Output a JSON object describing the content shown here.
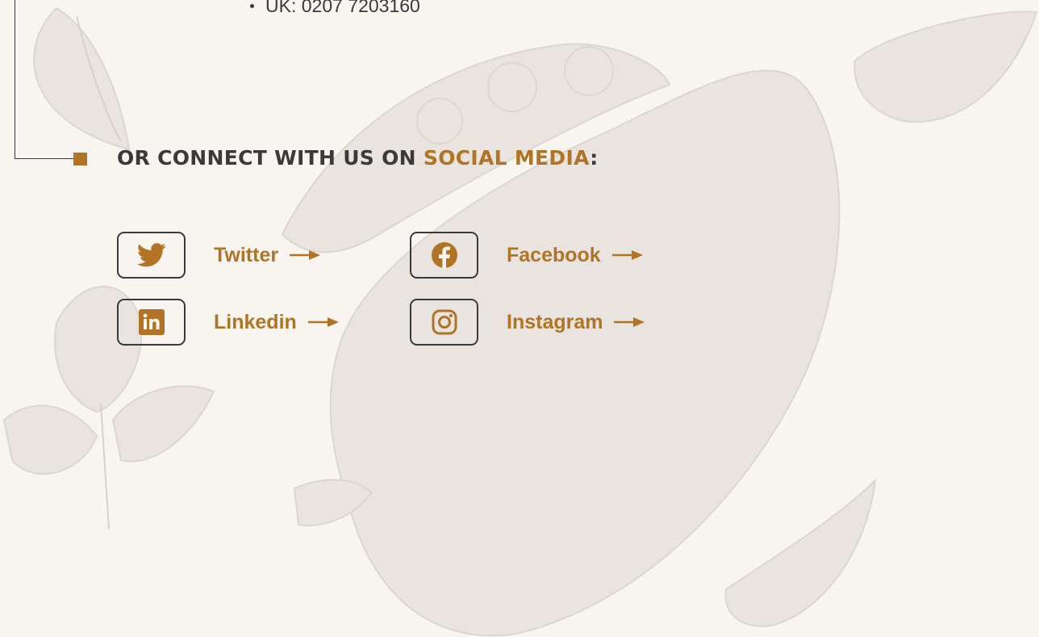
{
  "contact": {
    "phone_uk": "UK: 0207 7203160"
  },
  "section": {
    "heading_prefix": "OR CONNECT WITH US ON ",
    "heading_accent": "SOCIAL MEDIA",
    "heading_suffix": ":"
  },
  "social": {
    "twitter": {
      "label": "Twitter",
      "icon": "twitter-bird-icon"
    },
    "facebook": {
      "label": "Facebook",
      "icon": "facebook-icon"
    },
    "linkedin": {
      "label": "Linkedin",
      "icon": "linkedin-icon"
    },
    "instagram": {
      "label": "Instagram",
      "icon": "instagram-icon"
    }
  },
  "colors": {
    "background": "#f8f4f0",
    "text": "#3a3a3a",
    "accent": "#b07424",
    "sketch": "#e6e1dc"
  }
}
